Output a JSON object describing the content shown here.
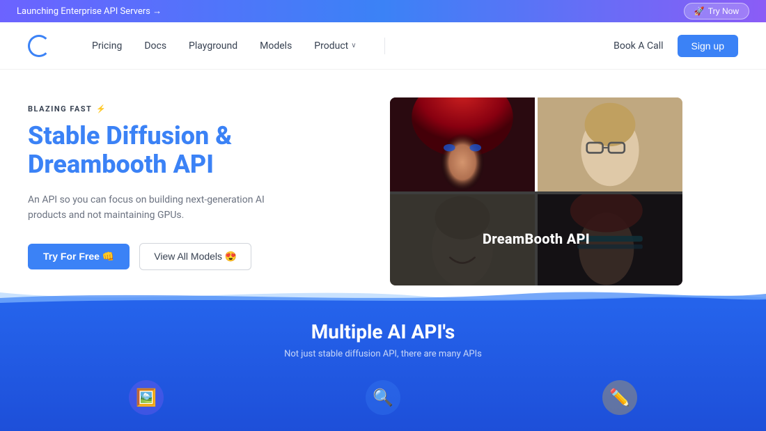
{
  "banner": {
    "text": "Launching Enterprise API Servers →",
    "try_now": "Try Now",
    "arrow": "→"
  },
  "nav": {
    "pricing": "Pricing",
    "docs": "Docs",
    "playground": "Playground",
    "models": "Models",
    "product": "Product",
    "chevron": "∨",
    "book_call": "Book A Call",
    "signup": "Sign up"
  },
  "hero": {
    "badge": "BLAZING FAST",
    "badge_icon": "⚡",
    "title_line1": "Stable Diffusion &",
    "title_line2": "Dreambooth API",
    "description": "An API so you can focus on building next-generation AI products and not maintaining GPUs.",
    "try_free": "Try For Free 👊",
    "view_models": "View All Models 😍",
    "dreambooth_label": "DreamBooth API"
  },
  "blue_section": {
    "title": "Multiple AI API's",
    "subtitle": "Not just stable diffusion API, there are many APIs",
    "icons": [
      {
        "name": "image-icon",
        "emoji": "🖼️",
        "color": "icon-purple"
      },
      {
        "name": "search-icon",
        "emoji": "🔍",
        "color": "icon-blue"
      },
      {
        "name": "edit-icon",
        "emoji": "✏️",
        "color": "icon-yellow"
      }
    ]
  }
}
